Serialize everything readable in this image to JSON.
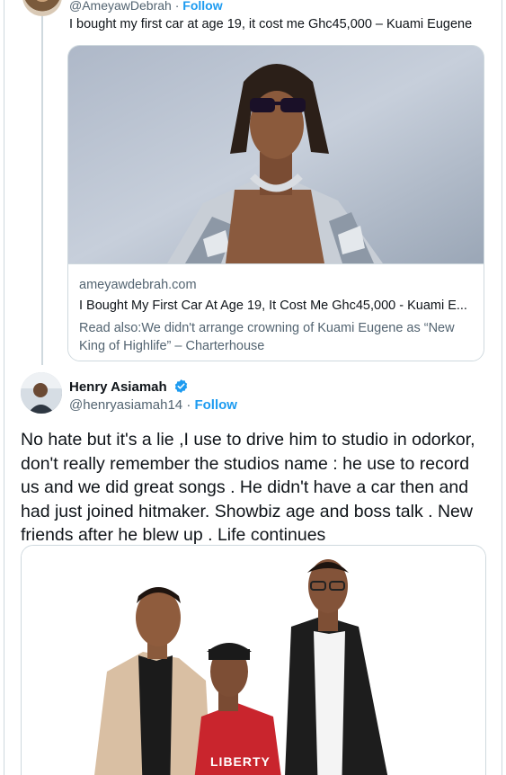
{
  "quoted_tweet": {
    "handle": "@AmeyawDebrah",
    "separator": "·",
    "follow_label": "Follow",
    "text": "I bought my first car at age 19, it cost me Ghc45,000 – Kuami Eugene",
    "link_card": {
      "domain": "ameyawdebrah.com",
      "title": "I Bought My First Car At Age 19, It Cost Me Ghc45,000 - Kuami E...",
      "description": "Read also:We didn't arrange crowning of Kuami Eugene as “New King of Highlife” – Charterhouse"
    }
  },
  "tweet": {
    "author_name": "Henry Asiamah",
    "handle": "@henryasiamah14",
    "separator": "·",
    "follow_label": "Follow",
    "text": "No hate but it's a lie ,I use to drive him to studio in odorkor, don't really remember the studios name : he use to record us and we did great songs . He didn't have a car then and had just joined hitmaker. Showbiz age and boss talk . New friends after he blew up . Life continues",
    "media_jersey_text": "LIBERTY"
  },
  "colors": {
    "accent": "#1d9bf0",
    "text_primary": "#0f1419",
    "text_secondary": "#536471",
    "border": "#cfd9de"
  },
  "icons": {
    "verified": "verified-badge-icon"
  }
}
